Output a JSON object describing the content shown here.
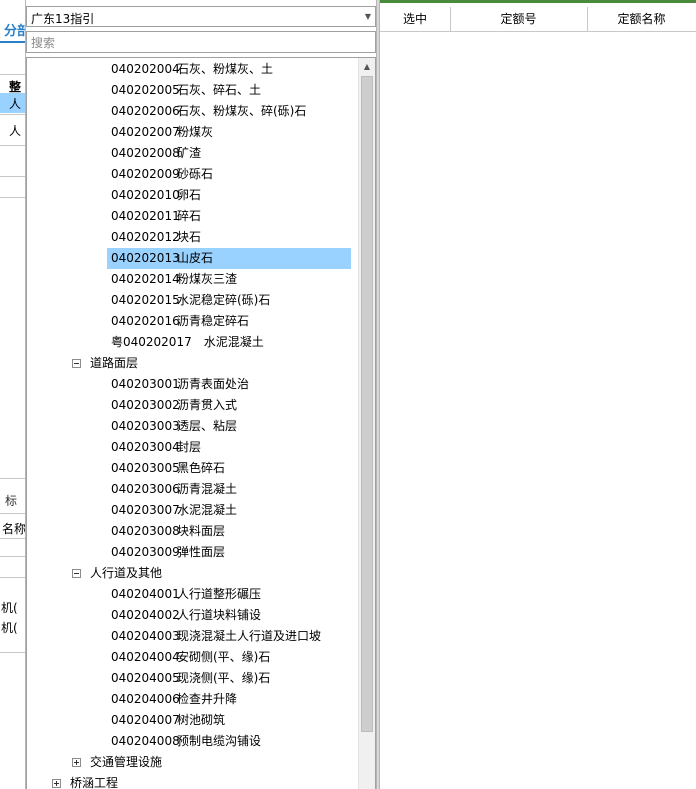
{
  "background_panel": {
    "tab_fragment": "分部",
    "header_fragment": "整",
    "row1_fragment": "人",
    "row2_fragment": "人",
    "label1_fragment": "标",
    "label2_fragment": "名称",
    "row3_fragment": "机(",
    "row4_fragment": "机("
  },
  "combo": {
    "value": "广东13指引"
  },
  "search": {
    "placeholder": "搜索"
  },
  "tree": {
    "nodes": [
      {
        "code": "040202004",
        "name": "石灰、粉煤灰、土"
      },
      {
        "code": "040202005",
        "name": "石灰、碎石、土"
      },
      {
        "code": "040202006",
        "name": "石灰、粉煤灰、碎(砾)石"
      },
      {
        "code": "040202007",
        "name": "粉煤灰"
      },
      {
        "code": "040202008",
        "name": "矿渣"
      },
      {
        "code": "040202009",
        "name": "砂砾石"
      },
      {
        "code": "040202010",
        "name": "卵石"
      },
      {
        "code": "040202011",
        "name": "碎石"
      },
      {
        "code": "040202012",
        "name": "块石"
      },
      {
        "code": "040202013",
        "name": "山皮石"
      },
      {
        "code": "040202014",
        "name": "粉煤灰三渣"
      },
      {
        "code": "040202015",
        "name": "水泥稳定碎(砾)石"
      },
      {
        "code": "040202016",
        "name": "沥青稳定碎石"
      },
      {
        "code": "粤040202017",
        "name": "水泥混凝土"
      },
      {
        "group": "道路面层"
      },
      {
        "code": "040203001",
        "name": "沥青表面处治"
      },
      {
        "code": "040203002",
        "name": "沥青贯入式"
      },
      {
        "code": "040203003",
        "name": "透层、粘层"
      },
      {
        "code": "040203004",
        "name": "封层"
      },
      {
        "code": "040203005",
        "name": "黑色碎石"
      },
      {
        "code": "040203006",
        "name": "沥青混凝土"
      },
      {
        "code": "040203007",
        "name": "水泥混凝土"
      },
      {
        "code": "040203008",
        "name": "块料面层"
      },
      {
        "code": "040203009",
        "name": "弹性面层"
      },
      {
        "group": "人行道及其他"
      },
      {
        "code": "040204001",
        "name": "人行道整形碾压"
      },
      {
        "code": "040204002",
        "name": "人行道块料铺设"
      },
      {
        "code": "040204003",
        "name": "现浇混凝土人行道及进口坡"
      },
      {
        "code": "040204004",
        "name": "安砌侧(平、缘)石"
      },
      {
        "code": "040204005",
        "name": "现浇侧(平、缘)石"
      },
      {
        "code": "040204006",
        "name": "检查井升降"
      },
      {
        "code": "040204007",
        "name": "树池砌筑"
      },
      {
        "code": "040204008",
        "name": "预制电缆沟铺设"
      },
      {
        "group": "交通管理设施"
      },
      {
        "group": "桥涵工程"
      }
    ]
  },
  "table": {
    "headers": [
      "选中",
      "定额号",
      "定额名称"
    ]
  }
}
